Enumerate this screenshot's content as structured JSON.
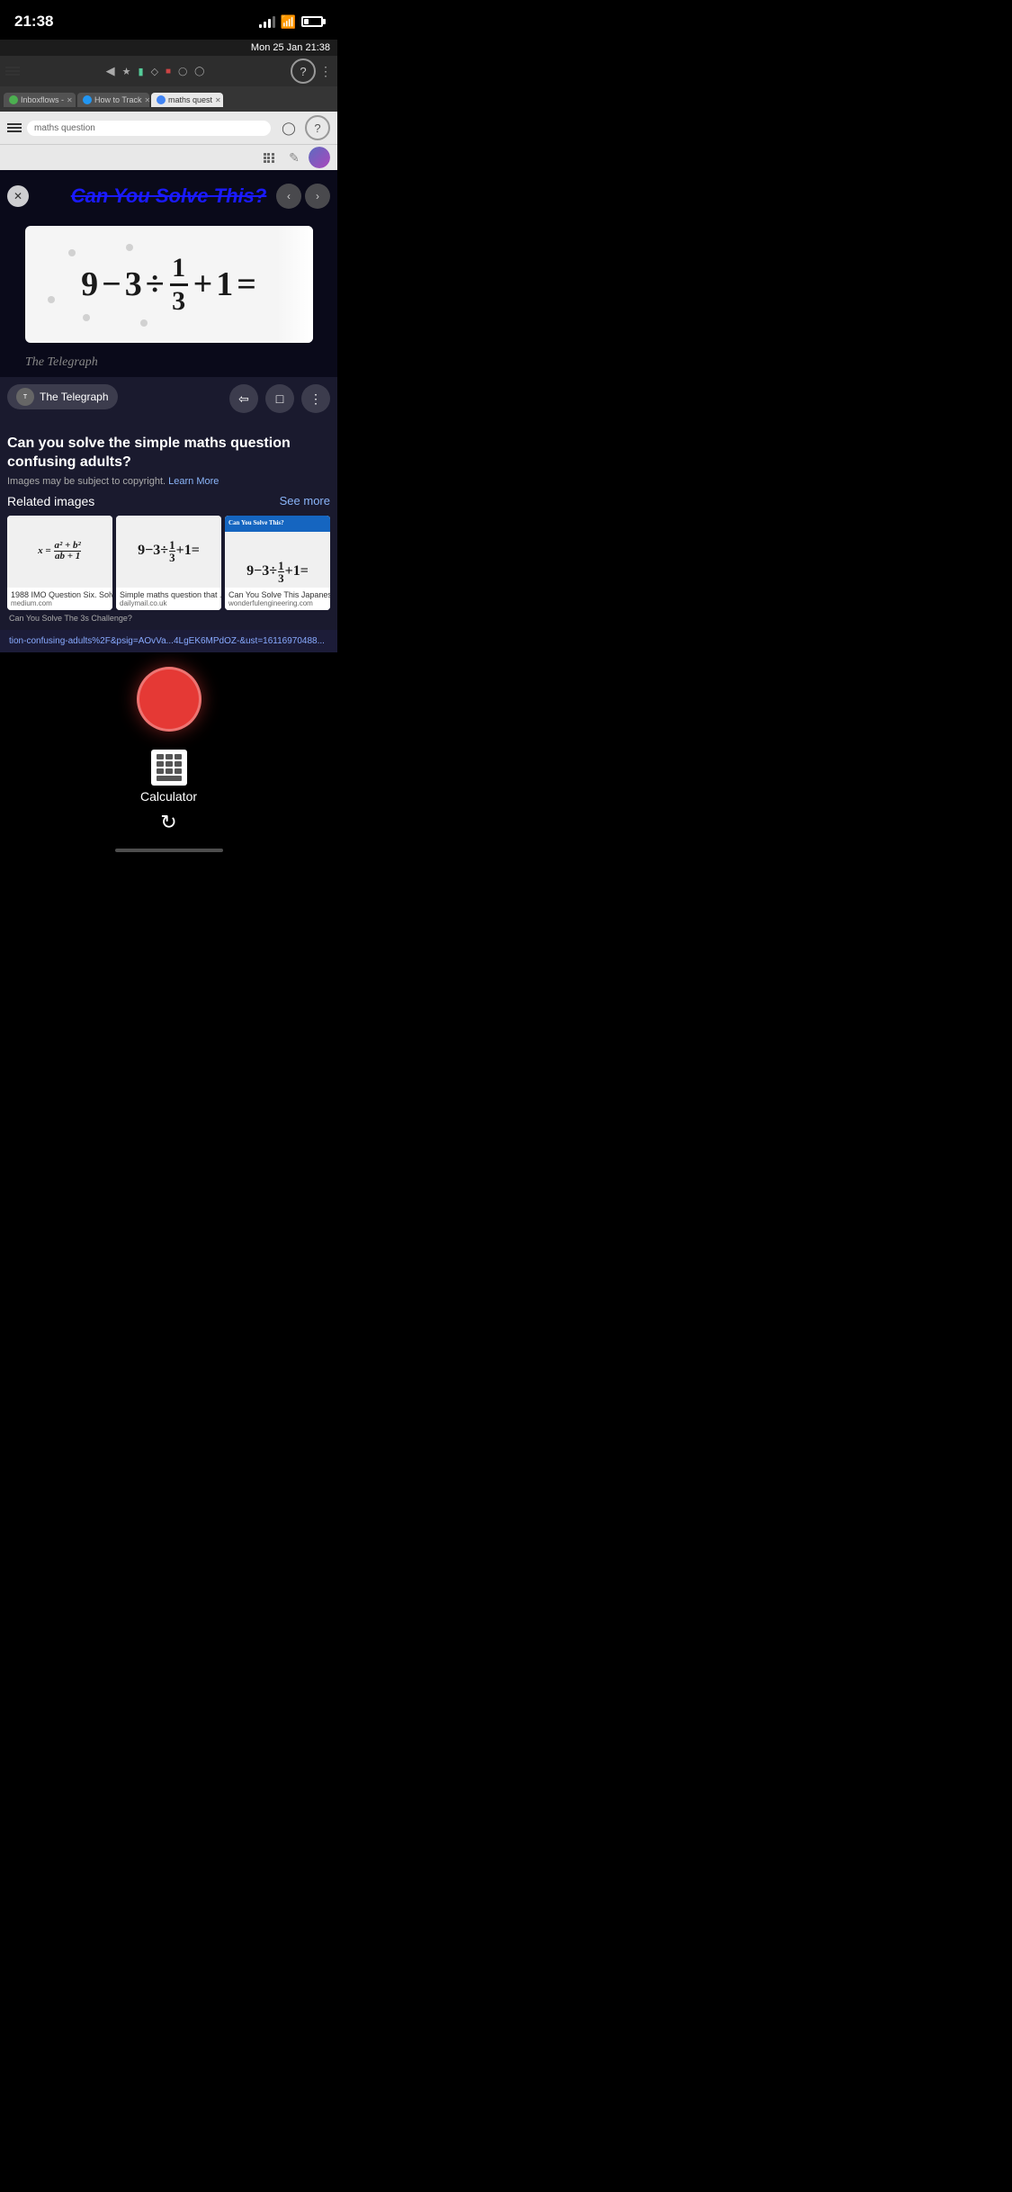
{
  "statusBar": {
    "time": "21:38",
    "date": "Mon 25 Jan 21:38"
  },
  "browser": {
    "tabs": [
      {
        "label": "Inboxflows -",
        "active": false,
        "favicon": "green"
      },
      {
        "label": "How to Track",
        "active": false,
        "favicon": "blue"
      },
      {
        "label": "maths quest",
        "active": true,
        "favicon": "google"
      }
    ],
    "addressBar": "maths question"
  },
  "puzzle": {
    "title": "Can You Solve This?",
    "equation": "9 − 3 ÷ ⅓ + 1 =",
    "attribution": "The Telegraph"
  },
  "results": {
    "source": "The Telegraph",
    "title": "Can you solve the simple maths question confusing adults?",
    "copyrightNote": "Images may be subject to copyright.",
    "learnMore": "Learn More",
    "relatedImages": "Related images",
    "seeMore": "See more"
  },
  "relatedItems": [
    {
      "mathExpr": "x = (a² + b²) / (ab + 1)",
      "source": "1988 IMO Question Six. Solvi...",
      "domain": "medium.com"
    },
    {
      "mathExpr": "9 − 3 ÷ ⅓ + 1 =",
      "source": "Simple maths question that ...",
      "domain": "dailymail.co.uk"
    },
    {
      "mathExpr": "9 − 3 ÷ ⅓ + 1 =",
      "source": "Can You Solve This Japanes...",
      "domain": "wonderfulengineering.com"
    }
  ],
  "urlBar": "tion-confusing-adults%2F&psig=AOvVa...4LgEK6MPdOZ-&ust=16116970488...",
  "bottomBar": {
    "calculatorLabel": "Calculator"
  },
  "icons": {
    "share": "⬡",
    "bookmark": "□",
    "more": "⋮",
    "back": "‹",
    "forward": "›",
    "refresh": "↺",
    "close": "✕",
    "leftArrow": "‹",
    "rightArrow": "›"
  }
}
